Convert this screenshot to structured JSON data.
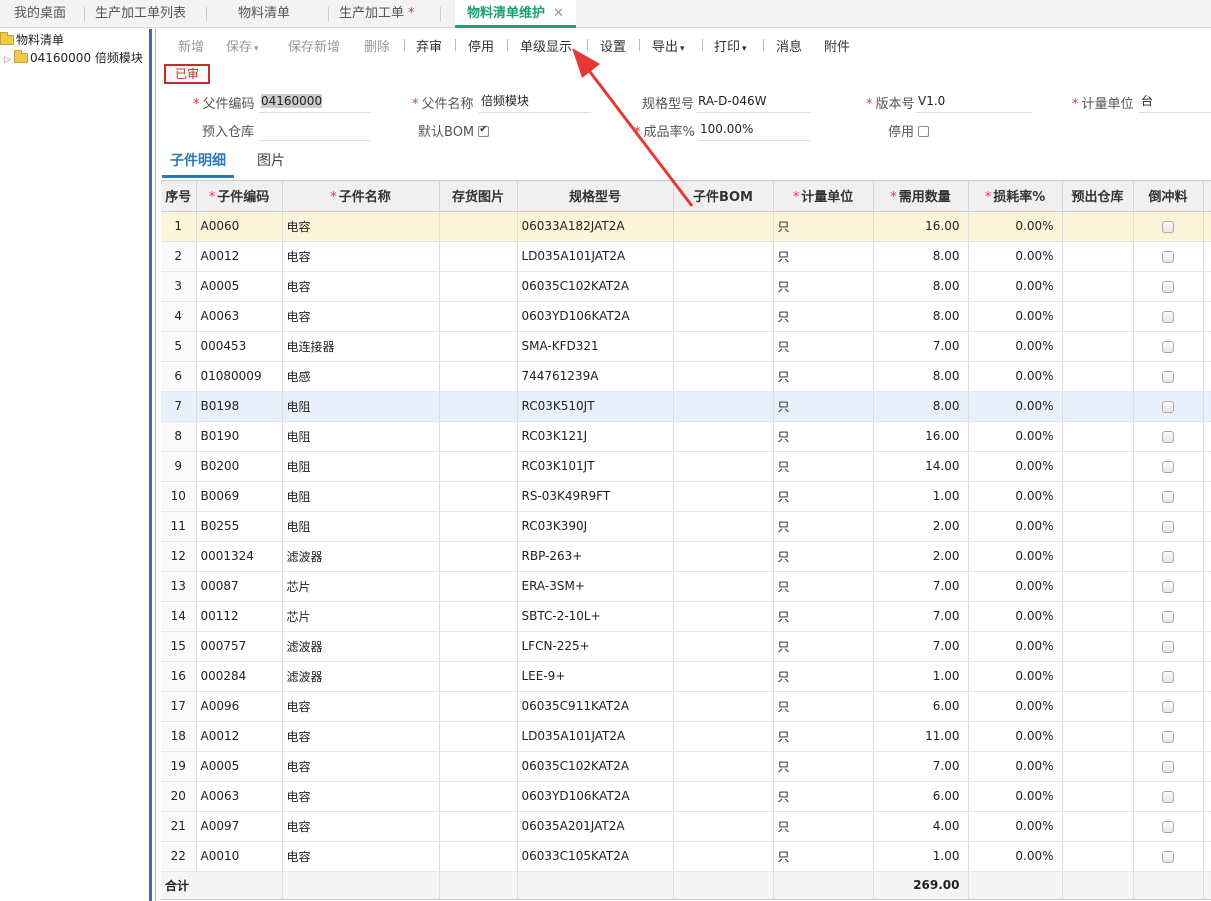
{
  "tabs": [
    {
      "label": "我的桌面",
      "active": false,
      "modified": false
    },
    {
      "label": "生产加工单列表",
      "active": false,
      "modified": false
    },
    {
      "label": "物料清单",
      "active": false,
      "modified": false
    },
    {
      "label": "生产加工单",
      "active": false,
      "modified": true
    },
    {
      "label": "物料清单维护",
      "active": true,
      "modified": false
    }
  ],
  "tab_modified_mark": "*",
  "tab_close_glyph": "✕",
  "tree": {
    "root": "物料清单",
    "child": "04160000 倍频模块"
  },
  "toolbar": {
    "new": "新增",
    "save": "保存",
    "save_new": "保存新增",
    "delete": "删除",
    "abandon": "弃审",
    "disable": "停用",
    "single_level": "单级显示",
    "settings": "设置",
    "export": "导出",
    "print": "打印",
    "message": "消息",
    "attachment": "附件"
  },
  "status_badge": "已审",
  "form": {
    "parent_code_label": "父件编码",
    "parent_code": "04160000",
    "parent_name_label": "父件名称",
    "parent_name": "倍频模块",
    "spec_label": "规格型号",
    "spec": "RA-D-046W",
    "version_label": "版本号",
    "version": "V1.0",
    "unit_label": "计量单位",
    "unit": "台",
    "warehouse_in_label": "预入仓库",
    "warehouse_in": "",
    "default_bom_label": "默认BOM",
    "default_bom_checked": true,
    "yield_label": "成品率%",
    "yield": "100.00%",
    "disabled_label": "停用",
    "disabled_checked": false
  },
  "sub_tabs": {
    "detail": "子件明细",
    "picture": "图片"
  },
  "grid": {
    "headers": {
      "index": "序号",
      "code": "子件编码",
      "name": "子件名称",
      "stock_img": "存货图片",
      "spec": "规格型号",
      "bom": "子件BOM",
      "unit": "计量单位",
      "qty": "需用数量",
      "loss": "损耗率%",
      "warehouse_out": "预出仓库",
      "backflush": "倒冲料"
    },
    "rows": [
      {
        "index": "1",
        "code": "A0060",
        "name": "电容",
        "spec": "06033A182JAT2A",
        "unit": "只",
        "qty": "16.00",
        "loss": "0.00%"
      },
      {
        "index": "2",
        "code": "A0012",
        "name": "电容",
        "spec": "LD035A101JAT2A",
        "unit": "只",
        "qty": "8.00",
        "loss": "0.00%"
      },
      {
        "index": "3",
        "code": "A0005",
        "name": "电容",
        "spec": "06035C102KAT2A",
        "unit": "只",
        "qty": "8.00",
        "loss": "0.00%"
      },
      {
        "index": "4",
        "code": "A0063",
        "name": "电容",
        "spec": "0603YD106KAT2A",
        "unit": "只",
        "qty": "8.00",
        "loss": "0.00%"
      },
      {
        "index": "5",
        "code": "000453",
        "name": "电连接器",
        "spec": "SMA-KFD321",
        "unit": "只",
        "qty": "7.00",
        "loss": "0.00%"
      },
      {
        "index": "6",
        "code": "01080009",
        "name": "电感",
        "spec": "744761239A",
        "unit": "只",
        "qty": "8.00",
        "loss": "0.00%"
      },
      {
        "index": "7",
        "code": "B0198",
        "name": "电阻",
        "spec": "RC03K510JT",
        "unit": "只",
        "qty": "8.00",
        "loss": "0.00%"
      },
      {
        "index": "8",
        "code": "B0190",
        "name": "电阻",
        "spec": "RC03K121J",
        "unit": "只",
        "qty": "16.00",
        "loss": "0.00%"
      },
      {
        "index": "9",
        "code": "B0200",
        "name": "电阻",
        "spec": "RC03K101JT",
        "unit": "只",
        "qty": "14.00",
        "loss": "0.00%"
      },
      {
        "index": "10",
        "code": "B0069",
        "name": "电阻",
        "spec": "RS-03K49R9FT",
        "unit": "只",
        "qty": "1.00",
        "loss": "0.00%"
      },
      {
        "index": "11",
        "code": "B0255",
        "name": "电阻",
        "spec": "RC03K390J",
        "unit": "只",
        "qty": "2.00",
        "loss": "0.00%"
      },
      {
        "index": "12",
        "code": "0001324",
        "name": "滤波器",
        "spec": "RBP-263+",
        "unit": "只",
        "qty": "2.00",
        "loss": "0.00%"
      },
      {
        "index": "13",
        "code": "00087",
        "name": "芯片",
        "spec": "ERA-3SM+",
        "unit": "只",
        "qty": "7.00",
        "loss": "0.00%"
      },
      {
        "index": "14",
        "code": "00112",
        "name": "芯片",
        "spec": "SBTC-2-10L+",
        "unit": "只",
        "qty": "7.00",
        "loss": "0.00%"
      },
      {
        "index": "15",
        "code": "000757",
        "name": "滤波器",
        "spec": "LFCN-225+",
        "unit": "只",
        "qty": "7.00",
        "loss": "0.00%"
      },
      {
        "index": "16",
        "code": "000284",
        "name": "滤波器",
        "spec": "LEE-9+",
        "unit": "只",
        "qty": "1.00",
        "loss": "0.00%"
      },
      {
        "index": "17",
        "code": "A0096",
        "name": "电容",
        "spec": "06035C911KAT2A",
        "unit": "只",
        "qty": "6.00",
        "loss": "0.00%"
      },
      {
        "index": "18",
        "code": "A0012",
        "name": "电容",
        "spec": "LD035A101JAT2A",
        "unit": "只",
        "qty": "11.00",
        "loss": "0.00%"
      },
      {
        "index": "19",
        "code": "A0005",
        "name": "电容",
        "spec": "06035C102KAT2A",
        "unit": "只",
        "qty": "7.00",
        "loss": "0.00%"
      },
      {
        "index": "20",
        "code": "A0063",
        "name": "电容",
        "spec": "0603YD106KAT2A",
        "unit": "只",
        "qty": "6.00",
        "loss": "0.00%"
      },
      {
        "index": "21",
        "code": "A0097",
        "name": "电容",
        "spec": "06035A201JAT2A",
        "unit": "只",
        "qty": "4.00",
        "loss": "0.00%"
      },
      {
        "index": "22",
        "code": "A0010",
        "name": "电容",
        "spec": "06033C105KAT2A",
        "unit": "只",
        "qty": "1.00",
        "loss": "0.00%"
      }
    ],
    "total_label": "合计",
    "total_qty": "269.00"
  },
  "colors": {
    "accent_green": "#1f9e6e",
    "status_red": "#b5322e",
    "selected_row": "#fcf5d9",
    "hover_row": "#e8f1fb",
    "annotation_arrow": "#e53935"
  },
  "icons": [
    "folder-icon",
    "expander-icon",
    "caret-down-icon",
    "close-icon",
    "checkbox-icon",
    "annotation-arrow"
  ]
}
